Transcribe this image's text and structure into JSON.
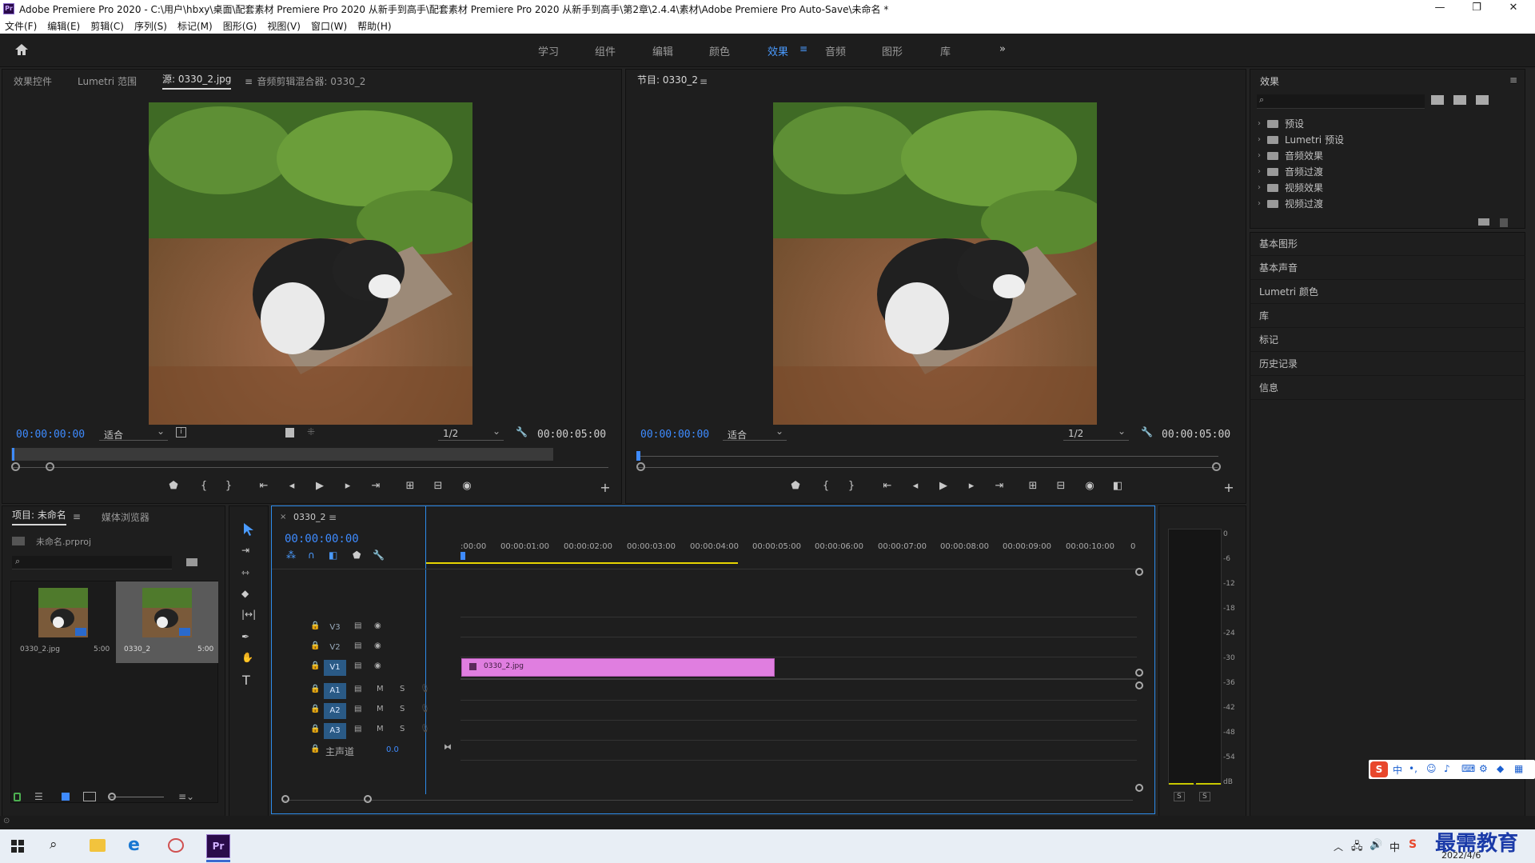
{
  "window": {
    "title": "Adobe Premiere Pro 2020 - C:\\用户\\hbxy\\桌面\\配套素材 Premiere Pro 2020 从新手到高手\\配套素材 Premiere Pro 2020 从新手到高手\\第2章\\2.4.4\\素材\\Adobe Premiere Pro Auto-Save\\未命名 *",
    "logo": "Pr",
    "controls": [
      "—",
      "❐",
      "✕"
    ]
  },
  "menu": [
    "文件(F)",
    "编辑(E)",
    "剪辑(C)",
    "序列(S)",
    "标记(M)",
    "图形(G)",
    "视图(V)",
    "窗口(W)",
    "帮助(H)"
  ],
  "workspaces": {
    "items": [
      "学习",
      "组件",
      "编辑",
      "颜色",
      "效果",
      "音频",
      "图形",
      "库"
    ],
    "active": "效果",
    "more": "»"
  },
  "source_panel": {
    "tabs": [
      "效果控件",
      "Lumetri 范围",
      "源: 0330_2.jpg",
      "音频剪辑混合器: 0330_2"
    ],
    "active_tab": "源: 0330_2.jpg",
    "timecode": "00:00:00:00",
    "fit": "适合",
    "resolution": "1/2",
    "duration": "00:00:05:00"
  },
  "program_panel": {
    "tab": "节目: 0330_2",
    "timecode": "00:00:00:00",
    "fit": "适合",
    "resolution": "1/2",
    "duration": "00:00:05:00"
  },
  "effects_panel": {
    "title": "效果",
    "tree": [
      "预设",
      "Lumetri 预设",
      "音频效果",
      "音频过渡",
      "视频效果",
      "视频过渡"
    ],
    "sections": [
      "基本图形",
      "基本声音",
      "Lumetri 颜色",
      "库",
      "标记",
      "历史记录",
      "信息"
    ]
  },
  "project_panel": {
    "tabs": [
      "项目: 未命名",
      "媒体浏览器"
    ],
    "file": "未命名.prproj",
    "items": [
      {
        "name": "0330_2.jpg",
        "duration": "5:00"
      },
      {
        "name": "0330_2",
        "duration": "5:00"
      }
    ]
  },
  "timeline": {
    "sequence": "0330_2",
    "timecode": "00:00:00:00",
    "ruler": [
      ":00:00",
      "00:00:01:00",
      "00:00:02:00",
      "00:00:03:00",
      "00:00:04:00",
      "00:00:05:00",
      "00:00:06:00",
      "00:00:07:00",
      "00:00:08:00",
      "00:00:09:00",
      "00:00:10:00",
      "0"
    ],
    "video_tracks": [
      "V3",
      "V2",
      "V1"
    ],
    "audio_tracks": [
      "A1",
      "A2",
      "A3"
    ],
    "master": {
      "label": "主声道",
      "value": "0.0"
    },
    "clip": {
      "name": "0330_2.jpg",
      "color": "#e07ee0"
    }
  },
  "meter": {
    "scale": [
      "0",
      "-6",
      "-12",
      "-18",
      "-24",
      "-30",
      "-36",
      "-42",
      "-48",
      "-54",
      "dB"
    ],
    "solo": [
      "S",
      "S"
    ]
  },
  "taskbar": {
    "date": "2022/4/6",
    "watermark": "最需教育"
  }
}
